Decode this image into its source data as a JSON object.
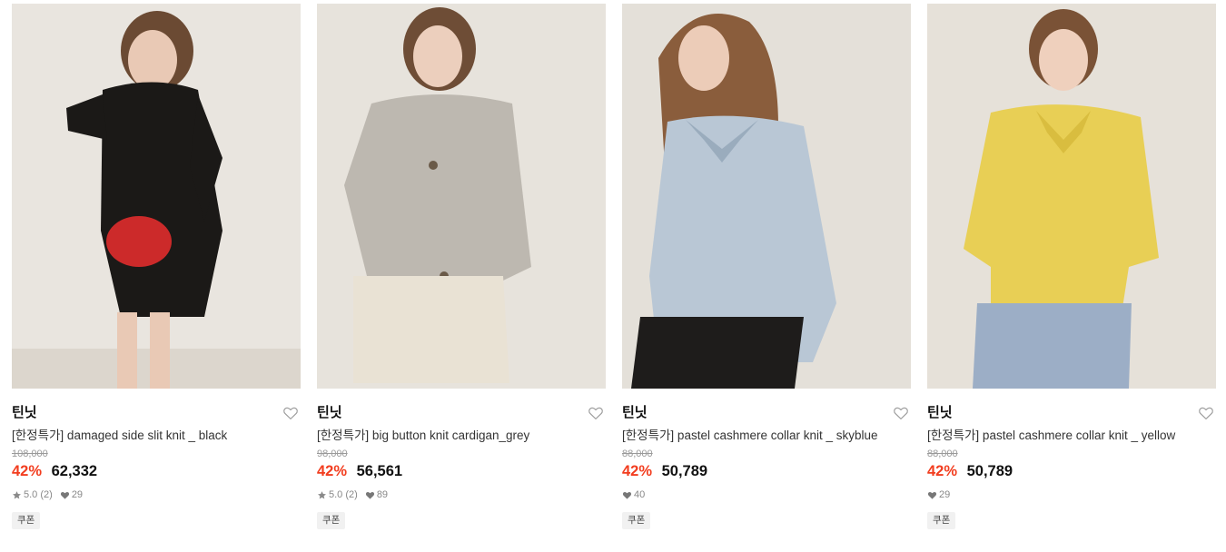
{
  "products": [
    {
      "brand": "틴닛",
      "title": "[한정특가] damaged side slit knit _ black",
      "original_price": "108,000",
      "discount": "42%",
      "price": "62,332",
      "rating": "5.0",
      "reviews": "(2)",
      "likes": "29",
      "badge": "쿠폰",
      "colors": {
        "bg": "#e9e5df",
        "top": "#1b1917",
        "bottom": "#2a2522",
        "accent": "#cc2a2a",
        "skin": "#e9c9b5",
        "hair": "#6b4a33"
      }
    },
    {
      "brand": "틴닛",
      "title": "[한정특가] big button knit cardigan_grey",
      "original_price": "98,000",
      "discount": "42%",
      "price": "56,561",
      "rating": "5.0",
      "reviews": "(2)",
      "likes": "89",
      "badge": "쿠폰",
      "colors": {
        "bg": "#e7e3dc",
        "top": "#bdb8b0",
        "bottom": "#e9e2d4",
        "accent": "#f2f0ec",
        "skin": "#eccfbd",
        "hair": "#6e4d36"
      }
    },
    {
      "brand": "틴닛",
      "title": "[한정특가] pastel cashmere collar knit _ skyblue",
      "original_price": "88,000",
      "discount": "42%",
      "price": "50,789",
      "rating": "",
      "reviews": "",
      "likes": "40",
      "badge": "쿠폰",
      "colors": {
        "bg": "#e4e0d9",
        "top": "#b9c7d5",
        "bottom": "#1e1c1b",
        "accent": "#9aacbd",
        "skin": "#ecccb8",
        "hair": "#8a5d3c"
      }
    },
    {
      "brand": "틴닛",
      "title": "[한정특가] pastel cashmere collar knit _ yellow",
      "original_price": "88,000",
      "discount": "42%",
      "price": "50,789",
      "rating": "",
      "reviews": "",
      "likes": "29",
      "badge": "쿠폰",
      "colors": {
        "bg": "#e6e1d9",
        "top": "#e8cf55",
        "bottom": "#9caec6",
        "accent": "#d9bd3f",
        "skin": "#efd0bd",
        "hair": "#7a5236"
      }
    }
  ],
  "icons": {
    "like": "heart-outline-icon",
    "star": "star-icon",
    "heart": "heart-icon"
  },
  "theme": {
    "discount_color": "#f23d1f"
  }
}
